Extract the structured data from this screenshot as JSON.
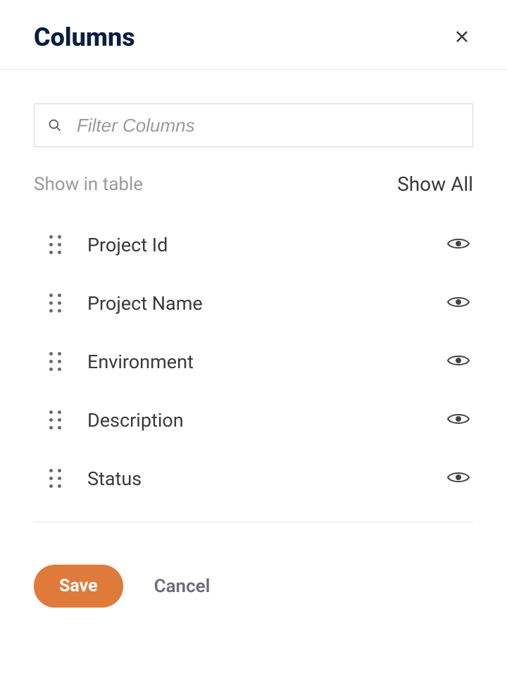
{
  "header": {
    "title": "Columns"
  },
  "search": {
    "placeholder": "Filter Columns",
    "value": ""
  },
  "list_header": {
    "show_in_table": "Show in table",
    "show_all": "Show All"
  },
  "columns": [
    {
      "label": "Project Id",
      "visible": true
    },
    {
      "label": "Project Name",
      "visible": true
    },
    {
      "label": "Environment",
      "visible": true
    },
    {
      "label": "Description",
      "visible": true
    },
    {
      "label": "Status",
      "visible": true
    }
  ],
  "footer": {
    "save": "Save",
    "cancel": "Cancel"
  }
}
